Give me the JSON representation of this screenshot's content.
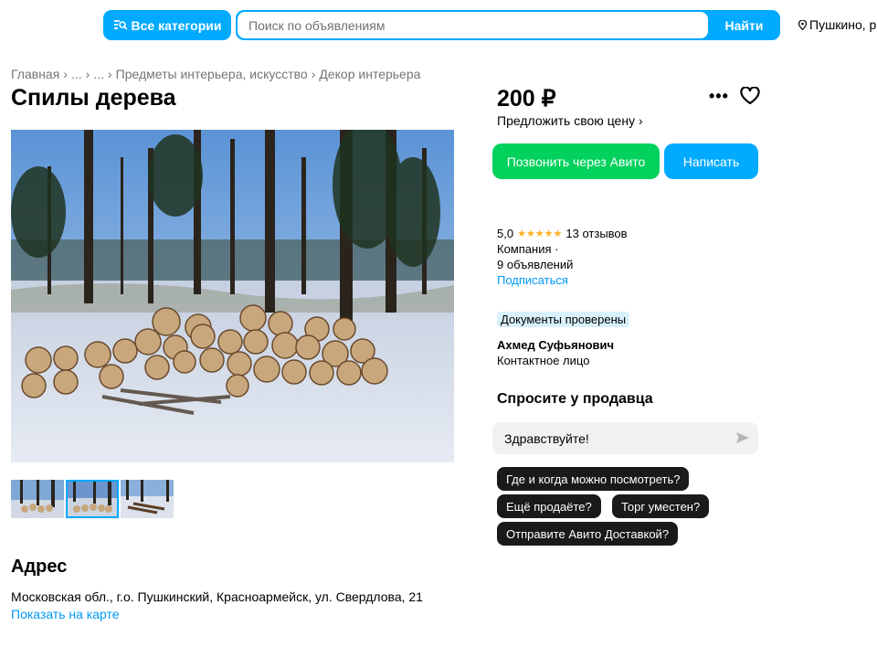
{
  "header": {
    "categories_label": "Все категории",
    "search_placeholder": "Поиск по объявлениям",
    "find_label": "Найти",
    "location": "Пушкино, р"
  },
  "breadcrumb": [
    "Главная",
    "...",
    "...",
    "Предметы интерьера, искусство",
    "Декор интерьера"
  ],
  "listing": {
    "title": "Спилы дерева",
    "price": "200 ₽",
    "offer_label": "Предложить свою цену ›"
  },
  "actions": {
    "call_label": "Позвонить через Авито",
    "write_label": "Написать"
  },
  "seller": {
    "rating": "5,0",
    "stars": "★★★★★",
    "reviews": "13 отзывов",
    "type": "Компания ·",
    "ads": "9 объявлений",
    "subscribe": "Подписаться",
    "docs_badge": "Документы проверены",
    "name": "Ахмед Суфьянович",
    "role": "Контактное лицо"
  },
  "chat": {
    "title": "Спросите у продавца",
    "message": "Здравствуйте!",
    "chips": [
      "Где и когда можно посмотреть?",
      "Ещё продаёте?",
      "Торг уместен?",
      "Отправите Авито Доставкой?"
    ]
  },
  "address": {
    "title": "Адрес",
    "text": "Московская обл., г.о. Пушкинский, Красноармейск, ул. Свердлова, 21",
    "map_link": "Показать на карте"
  },
  "colors": {
    "accent_blue": "#00aaff",
    "call_green": "#02d15c",
    "link_blue": "#0099f7",
    "chip_dark": "#1a1a1a"
  },
  "icons": [
    "search-icon",
    "location-pin-icon",
    "more-icon",
    "heart-icon",
    "send-icon"
  ],
  "gallery": {
    "thumbnail_count": 3,
    "active_index": 1
  }
}
